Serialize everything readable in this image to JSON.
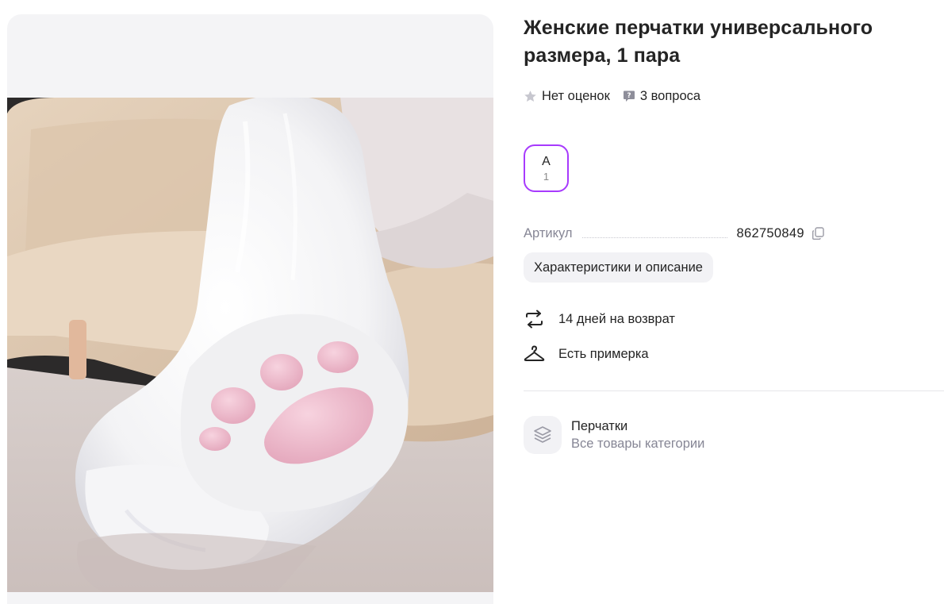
{
  "product": {
    "title": "Женские перчатки универсального размера, 1 пара",
    "rating_text": "Нет оценок",
    "questions_text": "3 вопроса",
    "image_alt": "Белая пушистая перчатка-лапка с розовыми подушечками"
  },
  "size_selector": {
    "selected": {
      "label": "A",
      "count": "1"
    }
  },
  "article": {
    "label": "Артикул",
    "value": "862750849"
  },
  "characteristics_button": "Характеристики и описание",
  "features": [
    {
      "icon": "return-arrows-icon",
      "text": "14 дней на возврат"
    },
    {
      "icon": "hanger-icon",
      "text": "Есть примерка"
    }
  ],
  "category": {
    "name": "Перчатки",
    "link_text": "Все товары категории",
    "icon": "layers-icon"
  },
  "colors": {
    "accent": "#a73afd",
    "text_primary": "#242424",
    "text_secondary": "#868695",
    "chip_bg": "#f2f2f5"
  }
}
